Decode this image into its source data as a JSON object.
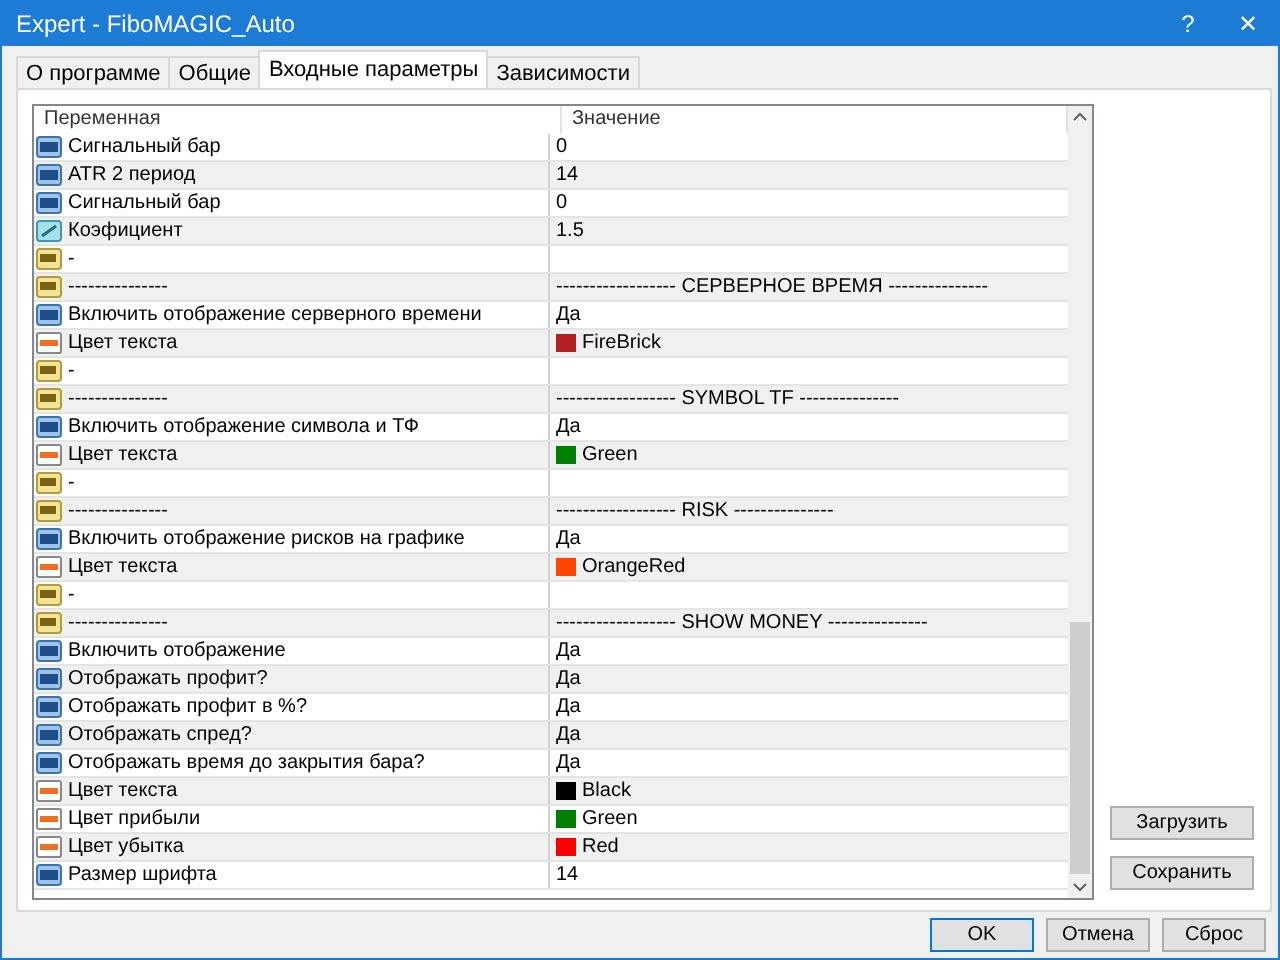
{
  "window": {
    "title": "Expert - FiboMAGIC_Auto",
    "help": "?",
    "close": "✕"
  },
  "tabs": [
    {
      "label": "О программе",
      "selected": false
    },
    {
      "label": "Общие",
      "selected": false
    },
    {
      "label": "Входные параметры",
      "selected": true
    },
    {
      "label": "Зависимости",
      "selected": false
    }
  ],
  "table": {
    "columns": [
      "Переменная",
      "Значение"
    ],
    "rows": [
      {
        "kind": "int",
        "name": "Сигнальный бар",
        "value": "0"
      },
      {
        "kind": "int",
        "name": "ATR 2 период",
        "value": "14"
      },
      {
        "kind": "int",
        "name": "Сигнальный бар",
        "value": "0"
      },
      {
        "kind": "double",
        "name": "Коэфициент",
        "value": "1.5"
      },
      {
        "kind": "string",
        "name": "-"
      },
      {
        "kind": "string",
        "name": "---------------",
        "value": "------------------ СЕРВЕРНОЕ ВРЕМЯ ---------------"
      },
      {
        "kind": "int",
        "name": "Включить отображение серверного времени",
        "value": "Да"
      },
      {
        "kind": "color",
        "name": "Цвет текста",
        "value": "FireBrick",
        "color": "#b22222"
      },
      {
        "kind": "string",
        "name": "-"
      },
      {
        "kind": "string",
        "name": "---------------",
        "value": "------------------ SYMBOL TF ---------------"
      },
      {
        "kind": "int",
        "name": "Включить отображение символа и ТФ",
        "value": "Да"
      },
      {
        "kind": "color",
        "name": "Цвет текста",
        "value": "Green",
        "color": "#008000"
      },
      {
        "kind": "string",
        "name": "-"
      },
      {
        "kind": "string",
        "name": "---------------",
        "value": "------------------ RISK ---------------"
      },
      {
        "kind": "int",
        "name": "Включить отображение рисков на графике",
        "value": "Да"
      },
      {
        "kind": "color",
        "name": "Цвет текста",
        "value": "OrangeRed",
        "color": "#ff4500"
      },
      {
        "kind": "string",
        "name": "-"
      },
      {
        "kind": "string",
        "name": "---------------",
        "value": "------------------ SHOW MONEY ---------------"
      },
      {
        "kind": "int",
        "name": "Включить отображение",
        "value": "Да"
      },
      {
        "kind": "int",
        "name": "Отображать профит?",
        "value": "Да"
      },
      {
        "kind": "int",
        "name": "Отображать профит в %?",
        "value": "Да"
      },
      {
        "kind": "int",
        "name": "Отображать спред?",
        "value": "Да"
      },
      {
        "kind": "int",
        "name": "Отображать время до закрытия бара?",
        "value": "Да"
      },
      {
        "kind": "color",
        "name": "Цвет текста",
        "value": "Black",
        "color": "#000000"
      },
      {
        "kind": "color",
        "name": "Цвет прибыли",
        "value": "Green",
        "color": "#008000"
      },
      {
        "kind": "color",
        "name": "Цвет убытка",
        "value": "Red",
        "color": "#ff0000"
      },
      {
        "kind": "int",
        "name": "Размер шрифта",
        "value": "14"
      }
    ]
  },
  "side_buttons": [
    "Загрузить",
    "Сохранить"
  ],
  "buttons": [
    {
      "label": "OK",
      "default": true
    },
    {
      "label": "Отмена",
      "default": false
    },
    {
      "label": "Сброс",
      "default": false
    }
  ]
}
